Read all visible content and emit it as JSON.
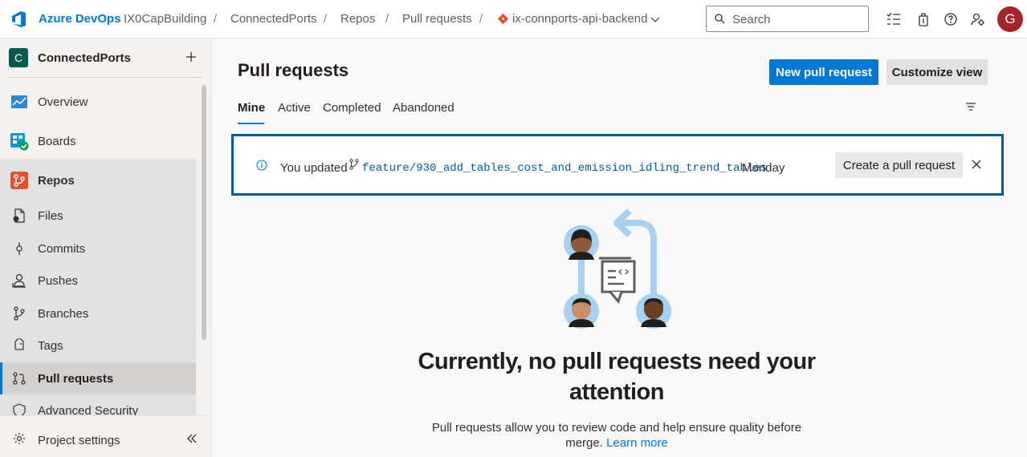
{
  "topbar": {
    "brand": "Azure DevOps",
    "breadcrumbs": [
      "IX0CapBuilding",
      "ConnectedPorts",
      "Repos",
      "Pull requests",
      "ix-connports-api-backend"
    ],
    "separator": "/",
    "search_placeholder": "Search",
    "avatar_initial": "G"
  },
  "sidebar": {
    "project_initial": "C",
    "project_name": "ConnectedPorts",
    "items": {
      "overview": "Overview",
      "boards": "Boards",
      "repos": "Repos",
      "files": "Files",
      "commits": "Commits",
      "pushes": "Pushes",
      "branches": "Branches",
      "tags": "Tags",
      "pull_requests": "Pull requests",
      "advanced_security": "Advanced Security"
    },
    "project_settings": "Project settings"
  },
  "main": {
    "title": "Pull requests",
    "new_pr_button": "New pull request",
    "customize_button": "Customize view",
    "tabs": [
      "Mine",
      "Active",
      "Completed",
      "Abandoned"
    ],
    "active_tab": "Mine",
    "banner": {
      "prefix": "You updated",
      "branch": "feature/930_add_tables_cost_and_emission_idling_trend_tables",
      "suffix": "Monday",
      "create_button": "Create a pull request"
    },
    "empty_title": "Currently, no pull requests need your attention",
    "empty_desc": "Pull requests allow you to review code and help ensure quality before merge.",
    "learn_more": "Learn more"
  },
  "colors": {
    "accent": "#0078d4",
    "avatar": "#a4262c",
    "project_badge": "#005a4e",
    "banner_border": "#005a9e"
  }
}
